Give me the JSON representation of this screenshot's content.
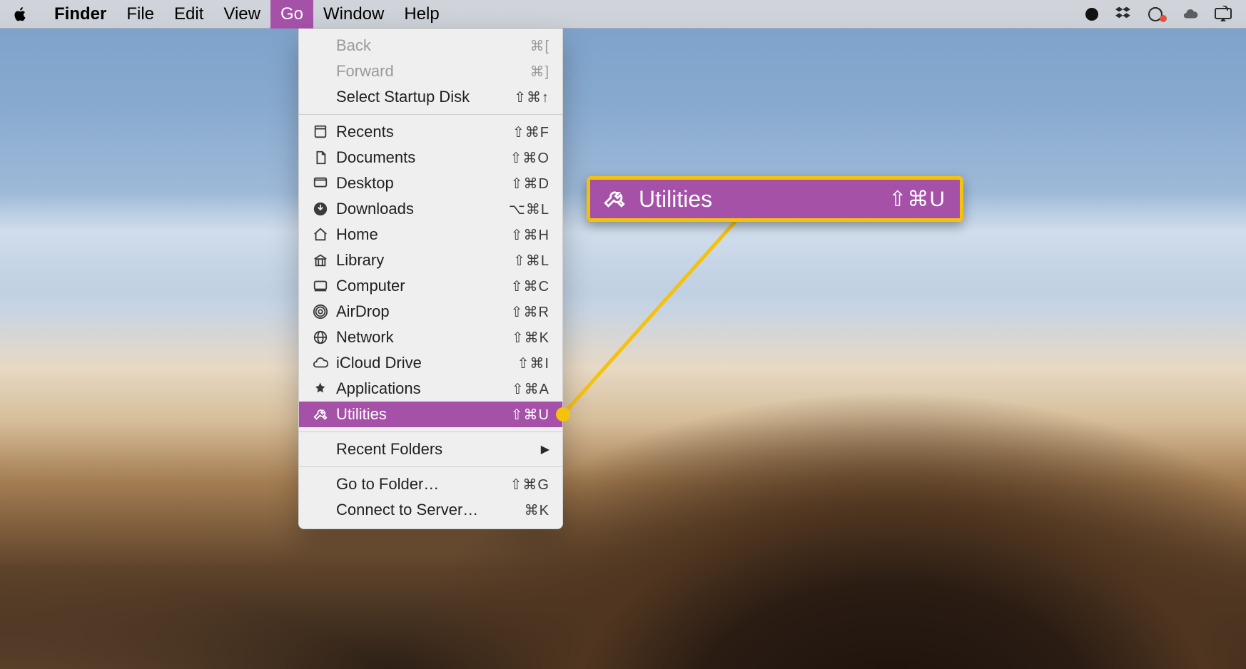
{
  "menubar": {
    "app_name": "Finder",
    "items": [
      {
        "label": "File"
      },
      {
        "label": "Edit"
      },
      {
        "label": "View"
      },
      {
        "label": "Go",
        "active": true
      },
      {
        "label": "Window"
      },
      {
        "label": "Help"
      }
    ]
  },
  "go_menu": {
    "group1": [
      {
        "label": "Back",
        "shortcut": "⌘[",
        "disabled": true,
        "icon": null
      },
      {
        "label": "Forward",
        "shortcut": "⌘]",
        "disabled": true,
        "icon": null
      },
      {
        "label": "Select Startup Disk",
        "shortcut": "⇧⌘↑",
        "icon": null
      }
    ],
    "group2": [
      {
        "label": "Recents",
        "shortcut": "⇧⌘F",
        "icon": "recents-icon"
      },
      {
        "label": "Documents",
        "shortcut": "⇧⌘O",
        "icon": "documents-icon"
      },
      {
        "label": "Desktop",
        "shortcut": "⇧⌘D",
        "icon": "desktop-icon"
      },
      {
        "label": "Downloads",
        "shortcut": "⌥⌘L",
        "icon": "downloads-icon"
      },
      {
        "label": "Home",
        "shortcut": "⇧⌘H",
        "icon": "home-icon"
      },
      {
        "label": "Library",
        "shortcut": "⇧⌘L",
        "icon": "library-icon"
      },
      {
        "label": "Computer",
        "shortcut": "⇧⌘C",
        "icon": "computer-icon"
      },
      {
        "label": "AirDrop",
        "shortcut": "⇧⌘R",
        "icon": "airdrop-icon"
      },
      {
        "label": "Network",
        "shortcut": "⇧⌘K",
        "icon": "network-icon"
      },
      {
        "label": "iCloud Drive",
        "shortcut": "⇧⌘I",
        "icon": "icloud-icon"
      },
      {
        "label": "Applications",
        "shortcut": "⇧⌘A",
        "icon": "applications-icon"
      },
      {
        "label": "Utilities",
        "shortcut": "⇧⌘U",
        "icon": "utilities-icon",
        "highlight": true
      }
    ],
    "group3": [
      {
        "label": "Recent Folders",
        "submenu": true
      }
    ],
    "group4": [
      {
        "label": "Go to Folder…",
        "shortcut": "⇧⌘G"
      },
      {
        "label": "Connect to Server…",
        "shortcut": "⌘K"
      }
    ]
  },
  "callout": {
    "label": "Utilities",
    "shortcut": "⇧⌘U"
  },
  "callout_theme": {
    "bg": "#a551a8",
    "border": "#f4c20d",
    "line": "#f4c20d"
  }
}
